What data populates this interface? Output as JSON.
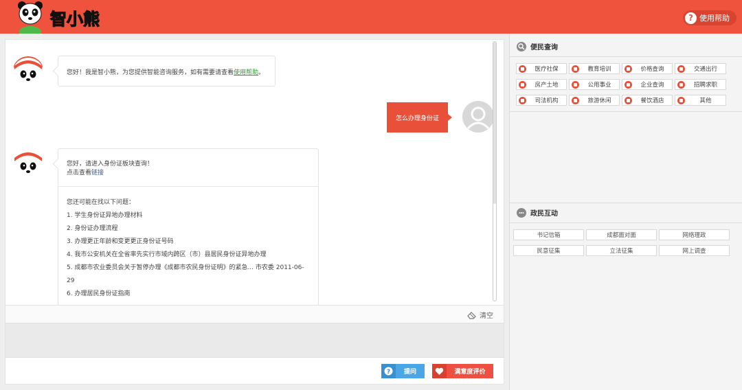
{
  "header": {
    "logo_text": "智小熊",
    "help_label": "使用帮助"
  },
  "chat": {
    "bot_greeting": "您好！我是智小熊，为您提供智能咨询服务，如有需要请查看",
    "bot_greeting_link": "使用帮助",
    "bot_greeting_end": "。",
    "user_message": "怎么办理身份证",
    "reply_line1": "您好，请进入身份证板块查询！",
    "reply_line2_prefix": "点击查看",
    "reply_line2_link": "链接",
    "suggest_title": "您还可能在找以下问题：",
    "suggestions": [
      "1. 学生身份证异地办理材料",
      "2. 身份证办理流程",
      "3. 办理更正年龄和变更更正身份证号码",
      "4. 我市公安机关在全省率先实行市域内跨区（市）县居民身份证异地办理",
      "5. 成都市农业委员会关于暂停办理《成都市农民身份证明》的紧急... 市农委 2011-06-29",
      "6. 办理居民身份证指南"
    ],
    "clear_label": "清空",
    "ask_label": "提问",
    "rate_label": "满意度评价"
  },
  "right": {
    "service_title": "便民查询",
    "services": [
      "医疗社保",
      "教育培训",
      "价格查询",
      "交通出行",
      "房产土地",
      "公用事业",
      "企业查询",
      "招聘求职",
      "司法机构",
      "旅游休闲",
      "餐饮酒店",
      "其他"
    ],
    "gov_title": "政民互动",
    "gov_items": [
      "书记信箱",
      "成都面对面",
      "网络理政",
      "民意征集",
      "立法征集",
      "网上调查"
    ]
  },
  "colors": {
    "brand_red": "#f0533d",
    "ask_blue": "#4aa6e6"
  }
}
